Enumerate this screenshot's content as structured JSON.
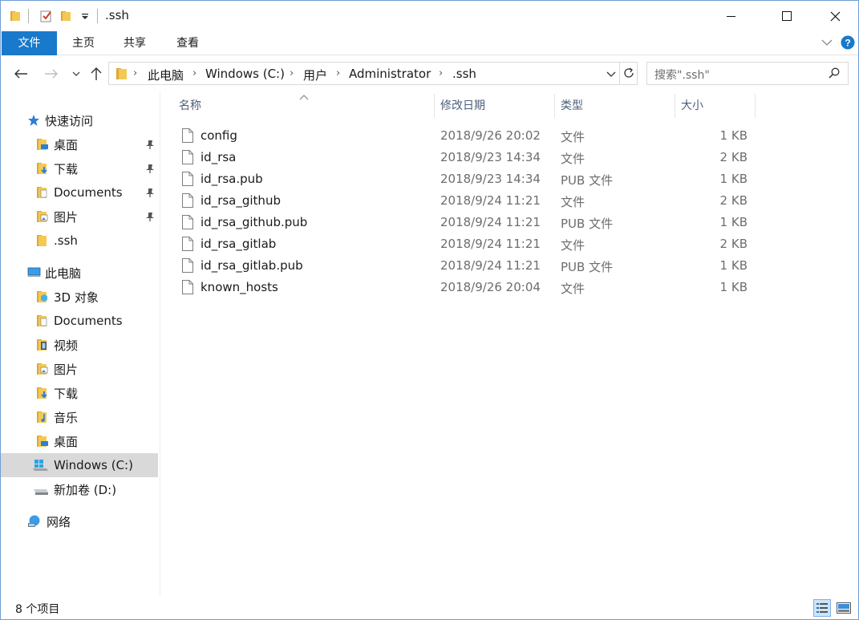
{
  "window": {
    "title": ".ssh",
    "controls": {
      "minimize": "—",
      "maximize": "☐",
      "close": "✕"
    }
  },
  "ribbon": {
    "tabs": [
      {
        "label": "文件"
      },
      {
        "label": "主页"
      },
      {
        "label": "共享"
      },
      {
        "label": "查看"
      }
    ]
  },
  "address": {
    "crumbs": [
      "此电脑",
      "Windows (C:)",
      "用户",
      "Administrator",
      ".ssh"
    ]
  },
  "search": {
    "placeholder": "搜索\".ssh\""
  },
  "nav": {
    "quick_access": {
      "label": "快速访问",
      "items": [
        {
          "label": "桌面",
          "pinned": true
        },
        {
          "label": "下载",
          "pinned": true
        },
        {
          "label": "Documents",
          "pinned": true
        },
        {
          "label": "图片",
          "pinned": true
        },
        {
          "label": ".ssh",
          "pinned": false
        }
      ]
    },
    "this_pc": {
      "label": "此电脑",
      "items": [
        {
          "label": "3D 对象"
        },
        {
          "label": "Documents"
        },
        {
          "label": "视频"
        },
        {
          "label": "图片"
        },
        {
          "label": "下载"
        },
        {
          "label": "音乐"
        },
        {
          "label": "桌面"
        },
        {
          "label": "Windows (C:)",
          "selected": true
        },
        {
          "label": "新加卷 (D:)"
        }
      ]
    },
    "network": {
      "label": "网络"
    }
  },
  "columns": {
    "name": "名称",
    "date": "修改日期",
    "type": "类型",
    "size": "大小"
  },
  "files": [
    {
      "name": "config",
      "date": "2018/9/26 20:02",
      "type": "文件",
      "size": "1 KB"
    },
    {
      "name": "id_rsa",
      "date": "2018/9/23 14:34",
      "type": "文件",
      "size": "2 KB"
    },
    {
      "name": "id_rsa.pub",
      "date": "2018/9/23 14:34",
      "type": "PUB 文件",
      "size": "1 KB"
    },
    {
      "name": "id_rsa_github",
      "date": "2018/9/24 11:21",
      "type": "文件",
      "size": "2 KB"
    },
    {
      "name": "id_rsa_github.pub",
      "date": "2018/9/24 11:21",
      "type": "PUB 文件",
      "size": "1 KB"
    },
    {
      "name": "id_rsa_gitlab",
      "date": "2018/9/24 11:21",
      "type": "文件",
      "size": "2 KB"
    },
    {
      "name": "id_rsa_gitlab.pub",
      "date": "2018/9/24 11:21",
      "type": "PUB 文件",
      "size": "1 KB"
    },
    {
      "name": "known_hosts",
      "date": "2018/9/26 20:04",
      "type": "文件",
      "size": "1 KB"
    }
  ],
  "status": {
    "item_count": "8 个项目"
  },
  "colors": {
    "accent": "#1979ca",
    "folder": "#e8b33d",
    "selected_bg": "#d9d9d9",
    "help": "#1979ca"
  }
}
